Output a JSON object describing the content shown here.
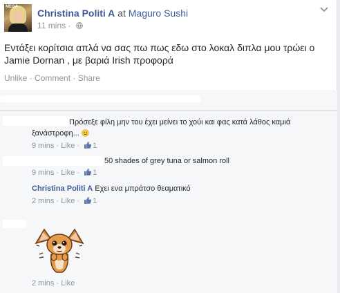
{
  "post": {
    "author": "Christina Politi A",
    "at": "at",
    "location": "Maguro Sushi",
    "time": "11 mins",
    "text": "Εντάξει κορίτσια απλά να σας πω πως εδω στο λοκαλ διπλα μου τρώει ο Jamie Dornan , με βαριά Irish προφορά",
    "actions": {
      "unlike": "Unlike",
      "comment": "Comment",
      "share": "Share",
      "sep": " · "
    }
  },
  "comments": [
    {
      "text": "Πρόσεξε φίλη μην του έχει μείνει το χούι και φας κατά λάθος καμιά ξανάστροφη...",
      "time": "9 mins",
      "like": "Like",
      "likes": "1"
    },
    {
      "text": "50 shades of grey tuna or salmon roll",
      "time": "9 mins",
      "like": "Like",
      "likes": "1"
    },
    {
      "author": "Christina Politi A",
      "text": "Εχει ενα μπράτσο θεαματικό",
      "time": "2 mins",
      "like": "Like",
      "likes": "1"
    },
    {
      "time": "2 mins",
      "like": "Like"
    }
  ],
  "avatar_tag": "MEGA",
  "colors": {
    "link": "#3b5998",
    "meta": "#90949c",
    "text": "#1d2129",
    "background": "#f6f7f9"
  },
  "icons": [
    "globe-icon",
    "chevron-down-icon",
    "thumbs-up-icon",
    "smiley-emoji",
    "chihuahua-sticker"
  ]
}
